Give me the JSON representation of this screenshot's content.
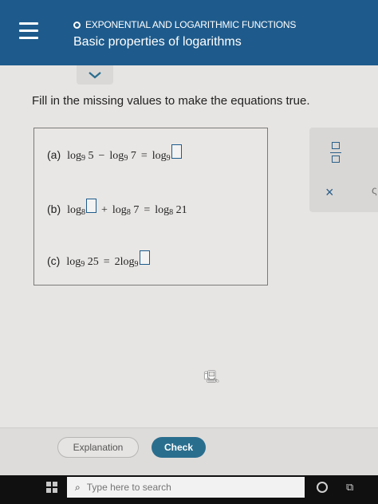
{
  "header": {
    "topic": "EXPONENTIAL AND LOGARITHMIC FUNCTIONS",
    "title": "Basic properties of logarithms"
  },
  "instruction": "Fill in the missing values to make the equations true.",
  "equations": {
    "a": {
      "label": "(a)",
      "log": "log",
      "base": "9",
      "arg1": "5",
      "op": "−",
      "arg2": "7",
      "eq": "="
    },
    "b": {
      "label": "(b)",
      "log": "log",
      "base": "8",
      "op": "+",
      "arg2": "7",
      "eq": "=",
      "rhs_arg": "21"
    },
    "c": {
      "label": "(c)",
      "log": "log",
      "base": "9",
      "arg1": "25",
      "eq": "=",
      "coef": "2"
    }
  },
  "tools": {
    "close_symbol": "×",
    "edge_glyph": "ς"
  },
  "buttons": {
    "explanation": "Explanation",
    "check": "Check"
  },
  "taskbar": {
    "search_placeholder": "Type here to search",
    "taskview_glyph": "⧉"
  },
  "colors": {
    "header_bg": "#1e5b8c",
    "check_button": "#2a6e8e"
  }
}
